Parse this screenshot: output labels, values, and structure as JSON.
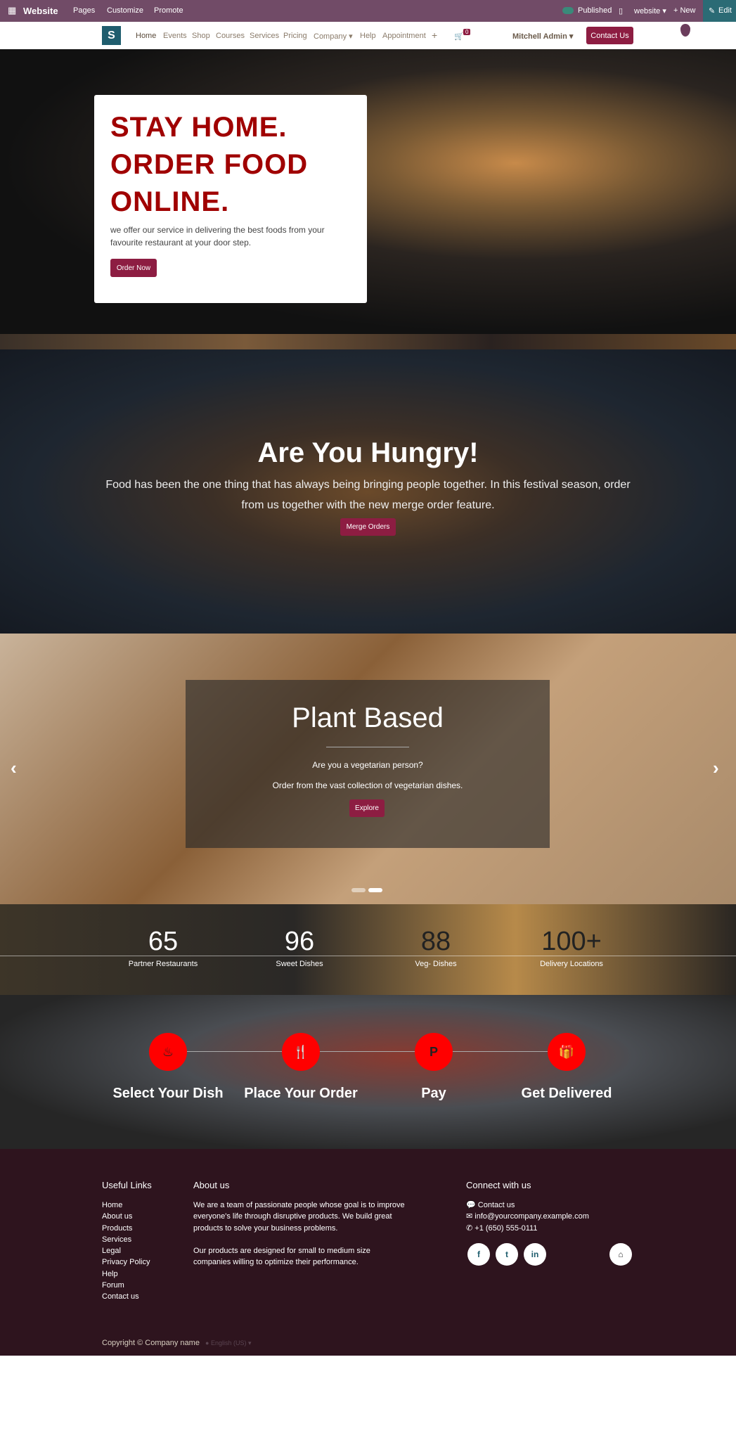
{
  "topbar": {
    "app": "Website",
    "menu": [
      "Pages",
      "Customize",
      "Promote"
    ],
    "published": "Published",
    "website": "website",
    "new": "New",
    "edit": "Edit",
    "color": "#714b67"
  },
  "navbar": {
    "items": [
      "Home",
      "Events",
      "Shop",
      "Courses",
      "Services",
      "Pricing",
      "Company",
      "Help",
      "Appointment"
    ],
    "cart_count": "0",
    "user": "Mitchell Admin",
    "contact": "Contact Us"
  },
  "hero": {
    "title_lines": [
      "STAY HOME.",
      "ORDER FOOD",
      "ONLINE."
    ],
    "text": "we offer our service in delivering the best foods from your favourite restaurant at your door step.",
    "button": "Order Now",
    "title_color": "#a00000"
  },
  "hungry": {
    "title": "Are You Hungry!",
    "text": "Food has been the one thing that has always being bringing people together. In this festival season, order from us together with the new merge order feature.",
    "button": "Merge Orders"
  },
  "carousel": {
    "title": "Plant Based",
    "line1": "Are you a vegetarian person?",
    "line2": "Order from the vast collection of vegetarian dishes.",
    "button": "Explore",
    "slides": 2,
    "active_slide": 2
  },
  "stats": [
    {
      "value": "65",
      "label": "Partner Restaurants"
    },
    {
      "value": "96",
      "label": "Sweet Dishes"
    },
    {
      "value": "88",
      "label": "Veg- Dishes"
    },
    {
      "value": "100+",
      "label": "Delivery Locations"
    }
  ],
  "steps": [
    {
      "icon": "fire-icon",
      "label": "Select Your Dish"
    },
    {
      "icon": "cutlery-icon",
      "label": "Place Your Order"
    },
    {
      "icon": "paypal-icon",
      "label": "Pay"
    },
    {
      "icon": "gift-icon",
      "label": "Get Delivered"
    }
  ],
  "footer": {
    "links_title": "Useful Links",
    "links": [
      "Home",
      "About us",
      "Products",
      "Services",
      "Legal",
      "Privacy Policy",
      "Help",
      "Forum",
      "Contact us"
    ],
    "about_title": "About us",
    "about_p1": "We are a team of passionate people whose goal is to improve everyone's life through disruptive products. We build great products to solve your business problems.",
    "about_p2": "Our products are designed for small to medium size companies willing to optimize their performance.",
    "connect_title": "Connect with us",
    "contact": "Contact us",
    "email": "info@yourcompany.example.com",
    "phone": "+1 (650) 555-0111",
    "copyright": "Copyright © Company name",
    "language": "English (US)"
  }
}
